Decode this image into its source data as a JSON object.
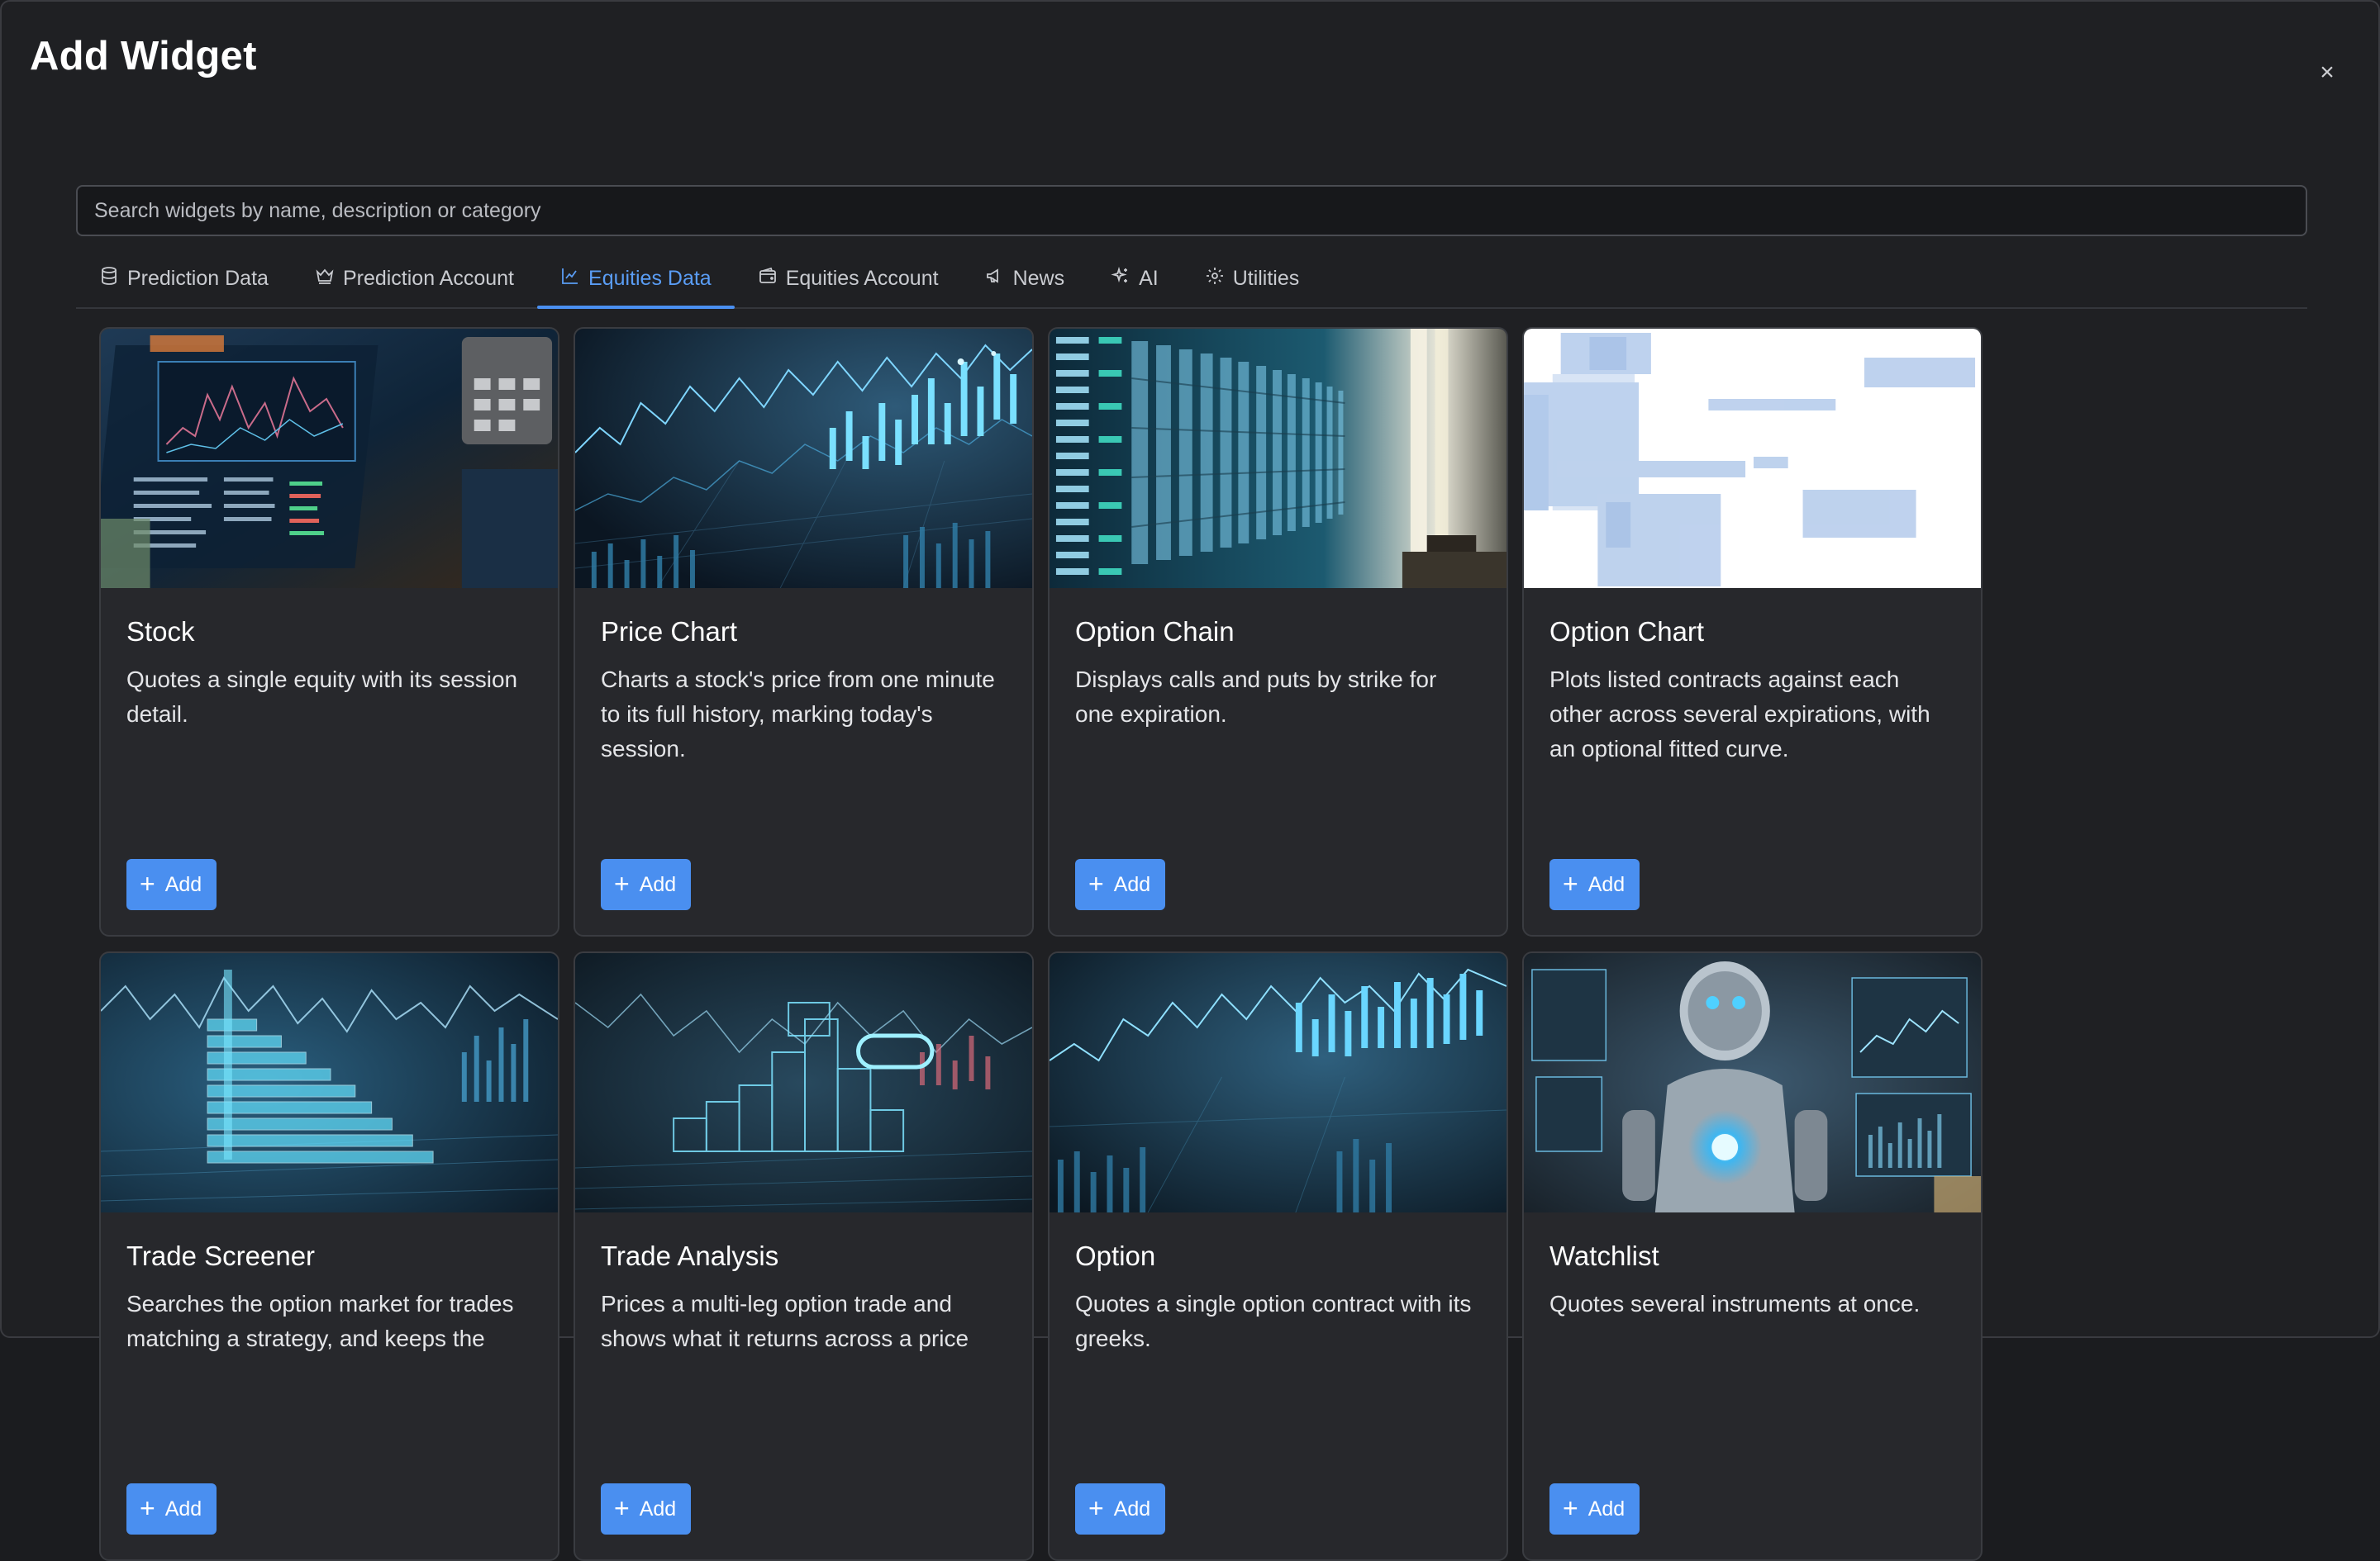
{
  "dialog": {
    "title": "Add Widget",
    "close_label": "×"
  },
  "search": {
    "placeholder": "Search widgets by name, description or category",
    "value": ""
  },
  "tabs": [
    {
      "label": "Prediction Data",
      "icon": "database-icon",
      "active": false
    },
    {
      "label": "Prediction Account",
      "icon": "crown-icon",
      "active": false
    },
    {
      "label": "Equities Data",
      "icon": "chart-line-icon",
      "active": true
    },
    {
      "label": "Equities Account",
      "icon": "wallet-icon",
      "active": false
    },
    {
      "label": "News",
      "icon": "megaphone-icon",
      "active": false
    },
    {
      "label": "AI",
      "icon": "sparkles-icon",
      "active": false
    },
    {
      "label": "Utilities",
      "icon": "gear-icon",
      "active": false
    }
  ],
  "accent_color": "#4a8ff0",
  "widgets": [
    {
      "title": "Stock",
      "description": "Quotes a single equity with its session detail.",
      "add_label": "Add",
      "image": "stock-terminal-image"
    },
    {
      "title": "Price Chart",
      "description": "Charts a stock's price from one minute to its full history, marking today's session.",
      "add_label": "Add",
      "image": "candlestick-chart-image"
    },
    {
      "title": "Option Chain",
      "description": "Displays calls and puts by strike for one expiration.",
      "add_label": "Add",
      "image": "quote-board-image"
    },
    {
      "title": "Option Chart",
      "description": "Plots listed contracts against each other across several expirations, with an optional fitted curve.",
      "add_label": "Add",
      "image": "placeholder-blocks-image"
    },
    {
      "title": "Trade Screener",
      "description": "Searches the option market for trades matching a strategy, and keeps the",
      "add_label": "Add",
      "image": "screener-bars-image"
    },
    {
      "title": "Trade Analysis",
      "description": "Prices a multi-leg option trade and shows what it returns across a price",
      "add_label": "Add",
      "image": "analysis-cubes-image"
    },
    {
      "title": "Option",
      "description": "Quotes a single option contract with its greeks.",
      "add_label": "Add",
      "image": "option-chart-image"
    },
    {
      "title": "Watchlist",
      "description": "Quotes several instruments at once.",
      "add_label": "Add",
      "image": "robot-dashboard-image"
    }
  ]
}
